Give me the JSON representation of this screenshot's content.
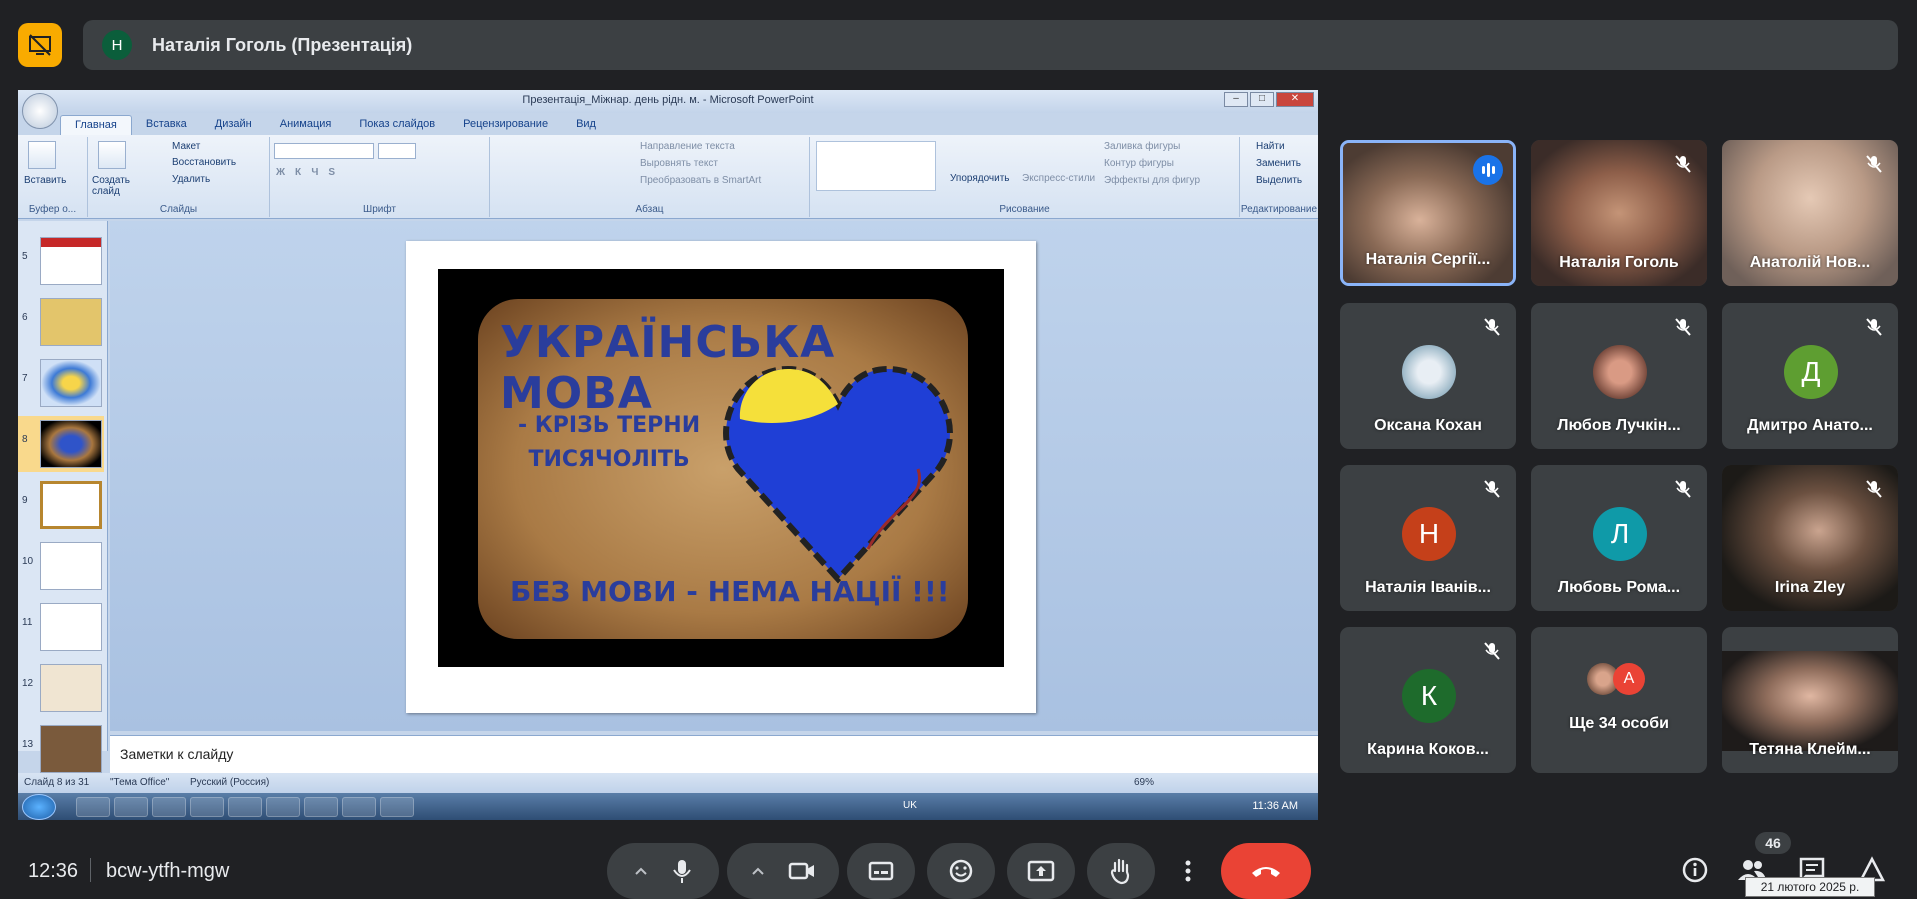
{
  "presenter": {
    "avatar_letter": "Н",
    "title": "Наталія Гоголь (Презентація)"
  },
  "powerpoint": {
    "window_title": "Презентація_Міжнар. день рідн. м. - Microsoft PowerPoint",
    "tabs": [
      "Главная",
      "Вставка",
      "Дизайн",
      "Анимация",
      "Показ слайдов",
      "Рецензирование",
      "Вид"
    ],
    "groups": {
      "clipboard": "Буфер о...",
      "slides": "Слайды",
      "font": "Шрифт",
      "paragraph": "Абзац",
      "drawing": "Рисование",
      "editing": "Редактирование"
    },
    "buttons": {
      "paste": "Вставить",
      "create_slide": "Создать слайд",
      "layout": "Макет",
      "restore": "Восстановить",
      "delete": "Удалить",
      "text_direction": "Направление текста",
      "align_text": "Выровнять текст",
      "smartart": "Преобразовать в SmartArt",
      "arrange": "Упорядочить",
      "express_styles": "Экспресс-стили",
      "shape_fill": "Заливка фигуры",
      "shape_outline": "Контур фигуры",
      "shape_effects": "Эффекты для фигур",
      "find": "Найти",
      "replace": "Заменить",
      "select": "Выделить"
    },
    "slide_numbers": [
      "5",
      "6",
      "7",
      "8",
      "9",
      "10",
      "11",
      "12",
      "13"
    ],
    "selected_slide": "8",
    "slide_text": {
      "title": "УКРАЇНСЬКА МОВА",
      "subtitle_line1": "- КРІЗЬ ТЕРНИ",
      "subtitle_line2": "ТИСЯЧОЛІТЬ",
      "footer": "БЕЗ МОВИ - НЕМА НАЦІЇ !!!"
    },
    "notes_placeholder": "Заметки к слайду",
    "status": {
      "slide_of": "Слайд 8 из 31",
      "theme": "\"Тема Office\"",
      "language": "Русский (Россия)",
      "zoom": "69%"
    },
    "taskbar": {
      "keyboard": "UK",
      "clock": "11:36 AM"
    }
  },
  "participants": [
    {
      "name": "Наталія Сергії...",
      "type": "video",
      "speaking": true
    },
    {
      "name": "Наталія Гоголь",
      "type": "video",
      "muted": true
    },
    {
      "name": "Анатолій Нов...",
      "type": "video",
      "muted": true
    },
    {
      "name": "Оксана Кохан",
      "type": "photo",
      "muted": true
    },
    {
      "name": "Любов Лучкін...",
      "type": "photo",
      "muted": true
    },
    {
      "name": "Дмитро Анато...",
      "type": "letter",
      "letter": "Д",
      "color": "#5e9e31",
      "muted": true
    },
    {
      "name": "Наталія Іванів...",
      "type": "letter",
      "letter": "Н",
      "color": "#c5401a",
      "muted": true
    },
    {
      "name": "Любовь Рома...",
      "type": "letter",
      "letter": "Л",
      "color": "#0f9aa8",
      "muted": true
    },
    {
      "name": "Irina Zley",
      "type": "video",
      "muted": true
    },
    {
      "name": "Карина Коков...",
      "type": "letter",
      "letter": "К",
      "color": "#1e6b2c",
      "muted": true
    },
    {
      "name": "Ще 34 особи",
      "type": "more",
      "letter": "А"
    },
    {
      "name": "Тетяна Клейм...",
      "type": "video"
    }
  ],
  "meeting": {
    "time": "12:36",
    "code": "bcw-ytfh-mgw",
    "participant_count": "46",
    "date_tooltip": "21 лютого 2025 р."
  },
  "colors": {
    "background": "#202124",
    "surface": "#3c4043",
    "accent": "#8ab4f8",
    "end_call": "#ea4335",
    "logo": "#f9ab00"
  }
}
